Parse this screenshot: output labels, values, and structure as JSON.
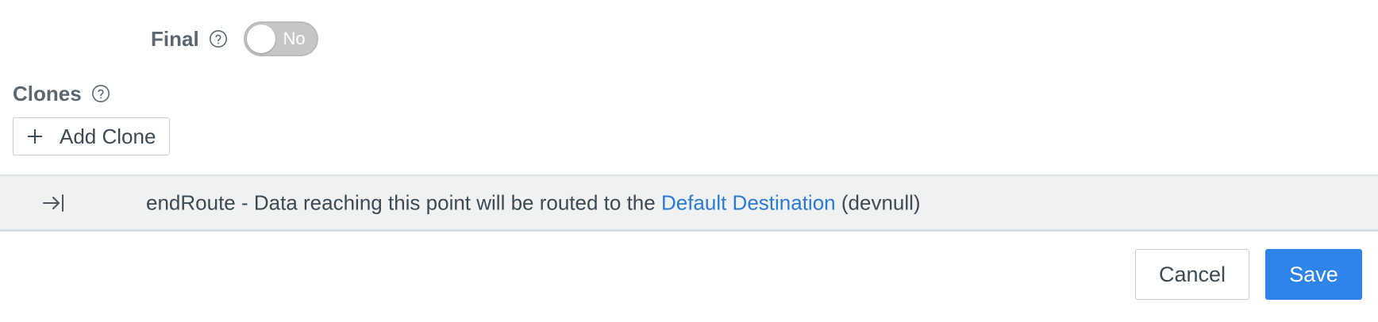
{
  "final_field": {
    "label": "Final",
    "help_icon": "question-circle-icon",
    "toggle_state": "No",
    "toggle_on": false
  },
  "clones_field": {
    "label": "Clones",
    "help_icon": "question-circle-icon",
    "add_button_icon": "plus-icon",
    "add_button_label": "Add Clone"
  },
  "end_route": {
    "icon": "arrow-right-to-bar-icon",
    "text_prefix": "endRoute - Data reaching this point will be routed to the ",
    "link_text": "Default Destination",
    "text_suffix": " (devnull)"
  },
  "actions": {
    "cancel_label": "Cancel",
    "save_label": "Save"
  },
  "colors": {
    "primary": "#2f84ea",
    "link": "#2b7bd6",
    "toggle_off": "#c4c6c8",
    "bar_background": "#f0f1f1"
  }
}
